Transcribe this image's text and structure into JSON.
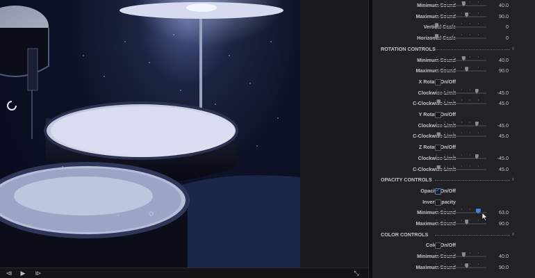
{
  "transport": {
    "start_icon": "⧏",
    "play_icon": "▶",
    "end_icon": "⧐",
    "fullscreen_icon": "⤡"
  },
  "inspector": {
    "accent_color": "#3e82e6",
    "rows": [
      {
        "type": "slider",
        "label": "Minimum Sound",
        "value": "40.0",
        "level": 0.54
      },
      {
        "type": "slider",
        "label": "Maximum Sound",
        "value": "90.0",
        "level": 0.6
      },
      {
        "type": "slider",
        "label": "Vertical Scale",
        "value": "0",
        "level": 0.0
      },
      {
        "type": "slider",
        "label": "Horizontal Scale",
        "value": "0",
        "level": 0.0
      },
      {
        "type": "section",
        "label": "ROTATION CONTROLS"
      },
      {
        "type": "slider",
        "label": "Minimum Sound",
        "value": "40.0",
        "level": 0.54
      },
      {
        "type": "slider",
        "label": "Maximum Sound",
        "value": "90.0",
        "level": 0.6
      },
      {
        "type": "checkbox",
        "label": "X Rotate On/Off",
        "checked": false
      },
      {
        "type": "slider",
        "label": "Clockwise Limit",
        "value": "-45.0",
        "level": 0.8
      },
      {
        "type": "slider",
        "label": "C-Clockwise Limit",
        "value": "45.0",
        "level": 0.04
      },
      {
        "type": "checkbox",
        "label": "Y Rotate On/Off",
        "checked": false
      },
      {
        "type": "slider",
        "label": "Clockwise Limit",
        "value": "-45.0",
        "level": 0.8
      },
      {
        "type": "slider",
        "label": "C-Clockwise Limit",
        "value": "45.0",
        "level": 0.04
      },
      {
        "type": "checkbox",
        "label": "Z Rotate On/Off",
        "checked": false
      },
      {
        "type": "slider",
        "label": "Clockwise Limit",
        "value": "-45.0",
        "level": 0.8
      },
      {
        "type": "slider",
        "label": "C-Clockwise Limit",
        "value": "45.0",
        "level": 0.04
      },
      {
        "type": "section",
        "label": "OPACITY CONTROLS"
      },
      {
        "type": "checkbox",
        "label": "Opacity On/Off",
        "checked": true
      },
      {
        "type": "checkbox",
        "label": "Invert Opacity",
        "checked": false
      },
      {
        "type": "slider",
        "label": "Minimum Sound",
        "value": "63.0",
        "level": 0.83,
        "active": true
      },
      {
        "type": "slider",
        "label": "Maximum Sound",
        "value": "90.0",
        "level": 0.6
      },
      {
        "type": "section",
        "label": "COLOR CONTROLS"
      },
      {
        "type": "checkbox",
        "label": "Color On/Off",
        "checked": false
      },
      {
        "type": "slider",
        "label": "Minimum Sound",
        "value": "40.0",
        "level": 0.54
      },
      {
        "type": "slider",
        "label": "Maximum Sound",
        "value": "90.0",
        "level": 0.6
      }
    ]
  },
  "keyframe": {
    "icon": "◇"
  }
}
